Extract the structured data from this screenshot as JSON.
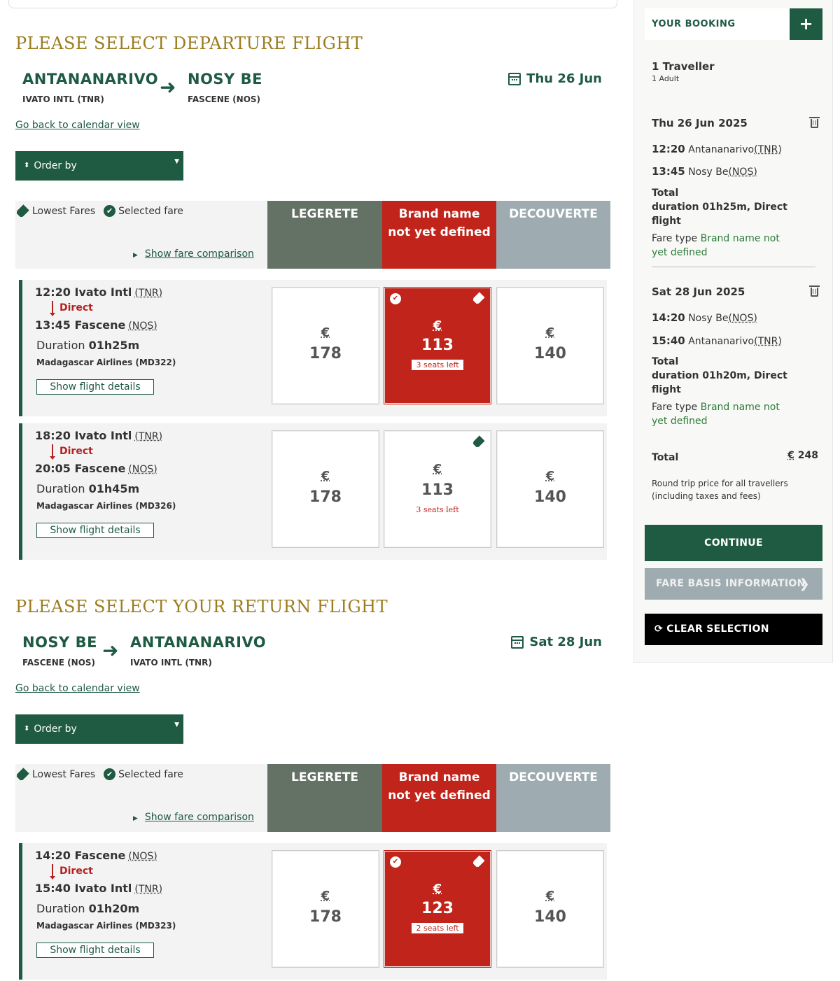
{
  "departure": {
    "title": "PLEASE SELECT DEPARTURE FLIGHT",
    "from_city": "ANTANANARIVO",
    "from_airport": "IVATO INTL (TNR)",
    "to_city": "NOSY BE",
    "to_airport": "FASCENE (NOS)",
    "date": "Thu 26 Jun",
    "back_link": "Go back to calendar view",
    "order_by": "Order by",
    "legend_lowest": "Lowest Fares",
    "legend_selected": "Selected fare",
    "fare_comparison": "Show fare comparison",
    "columns": [
      "LEGERETE",
      "Brand name not yet defined",
      "DECOUVERTE"
    ],
    "flights": [
      {
        "dep_time": "12:20 Ivato Intl",
        "dep_code": "(TNR)",
        "direct": "Direct",
        "arr_time": "13:45 Fascene",
        "arr_code": "(NOS)",
        "duration_label": "Duration",
        "duration": "01h25m",
        "airline": "Madagascar Airlines (MD322)",
        "details": "Show flight details",
        "fares": [
          {
            "currency": "€",
            "price": "178"
          },
          {
            "currency": "€",
            "price": "113",
            "seats": "3 seats left"
          },
          {
            "currency": "€",
            "price": "140"
          }
        ]
      },
      {
        "dep_time": "18:20 Ivato Intl",
        "dep_code": "(TNR)",
        "direct": "Direct",
        "arr_time": "20:05 Fascene",
        "arr_code": "(NOS)",
        "duration_label": "Duration",
        "duration": "01h45m",
        "airline": "Madagascar Airlines (MD326)",
        "details": "Show flight details",
        "fares": [
          {
            "currency": "€",
            "price": "178"
          },
          {
            "currency": "€",
            "price": "113",
            "seats": "3 seats left"
          },
          {
            "currency": "€",
            "price": "140"
          }
        ]
      }
    ]
  },
  "return": {
    "title": "PLEASE SELECT YOUR RETURN FLIGHT",
    "from_city": "NOSY BE",
    "from_airport": "FASCENE (NOS)",
    "to_city": "ANTANANARIVO",
    "to_airport": "IVATO INTL (TNR)",
    "date": "Sat 28 Jun",
    "back_link": "Go back to calendar view",
    "order_by": "Order by",
    "legend_lowest": "Lowest Fares",
    "legend_selected": "Selected fare",
    "fare_comparison": "Show fare comparison",
    "columns": [
      "LEGERETE",
      "Brand name not yet defined",
      "DECOUVERTE"
    ],
    "flights": [
      {
        "dep_time": "14:20 Fascene",
        "dep_code": "(NOS)",
        "direct": "Direct",
        "arr_time": "15:40 Ivato Intl",
        "arr_code": "(TNR)",
        "duration_label": "Duration",
        "duration": "01h20m",
        "airline": "Madagascar Airlines (MD323)",
        "details": "Show flight details",
        "fares": [
          {
            "currency": "€",
            "price": "178"
          },
          {
            "currency": "€",
            "price": "123",
            "seats": "2 seats left"
          },
          {
            "currency": "€",
            "price": "140"
          }
        ]
      }
    ]
  },
  "booking": {
    "title": "YOUR BOOKING",
    "plus": "+",
    "travellers": "1 Traveller",
    "travellers_detail": "1 Adult",
    "outbound": {
      "date": "Thu 26 Jun 2025",
      "dep_time": "12:20",
      "dep_city": "Antananarivo",
      "dep_code": "(TNR)",
      "arr_time": "13:45",
      "arr_city": "Nosy Be",
      "arr_code": "(NOS)",
      "total_label": "Total",
      "duration_text": "duration 01h25m, Direct",
      "flight_word": "flight",
      "fare_type_label": "Fare type",
      "fare_type_1": "Brand name not",
      "fare_type_2": "yet defined"
    },
    "inbound": {
      "date": "Sat 28 Jun 2025",
      "dep_time": "14:20",
      "dep_city": "Nosy Be",
      "dep_code": "(NOS)",
      "arr_time": "15:40",
      "arr_city": "Antananarivo",
      "arr_code": "(TNR)",
      "total_label": "Total",
      "duration_text": "duration 01h20m, Direct",
      "flight_word": "flight",
      "fare_type_label": "Fare type",
      "fare_type_1": "Brand name not",
      "fare_type_2": "yet defined"
    },
    "total_label": "Total",
    "total_currency": "€",
    "total_amount": "248",
    "note_1": "Round trip price for all travellers",
    "note_2": "(including taxes and fees)",
    "continue": "CONTINUE",
    "fare_basis": "FARE BASIS INFORMATION",
    "clear": "CLEAR SELECTION"
  },
  "colors": {
    "brand_green": "#1f5a43",
    "gold": "#9b7c1f",
    "selected_red": "#c0241b",
    "legerete": "#647266",
    "decouverte": "#9eabb0"
  }
}
